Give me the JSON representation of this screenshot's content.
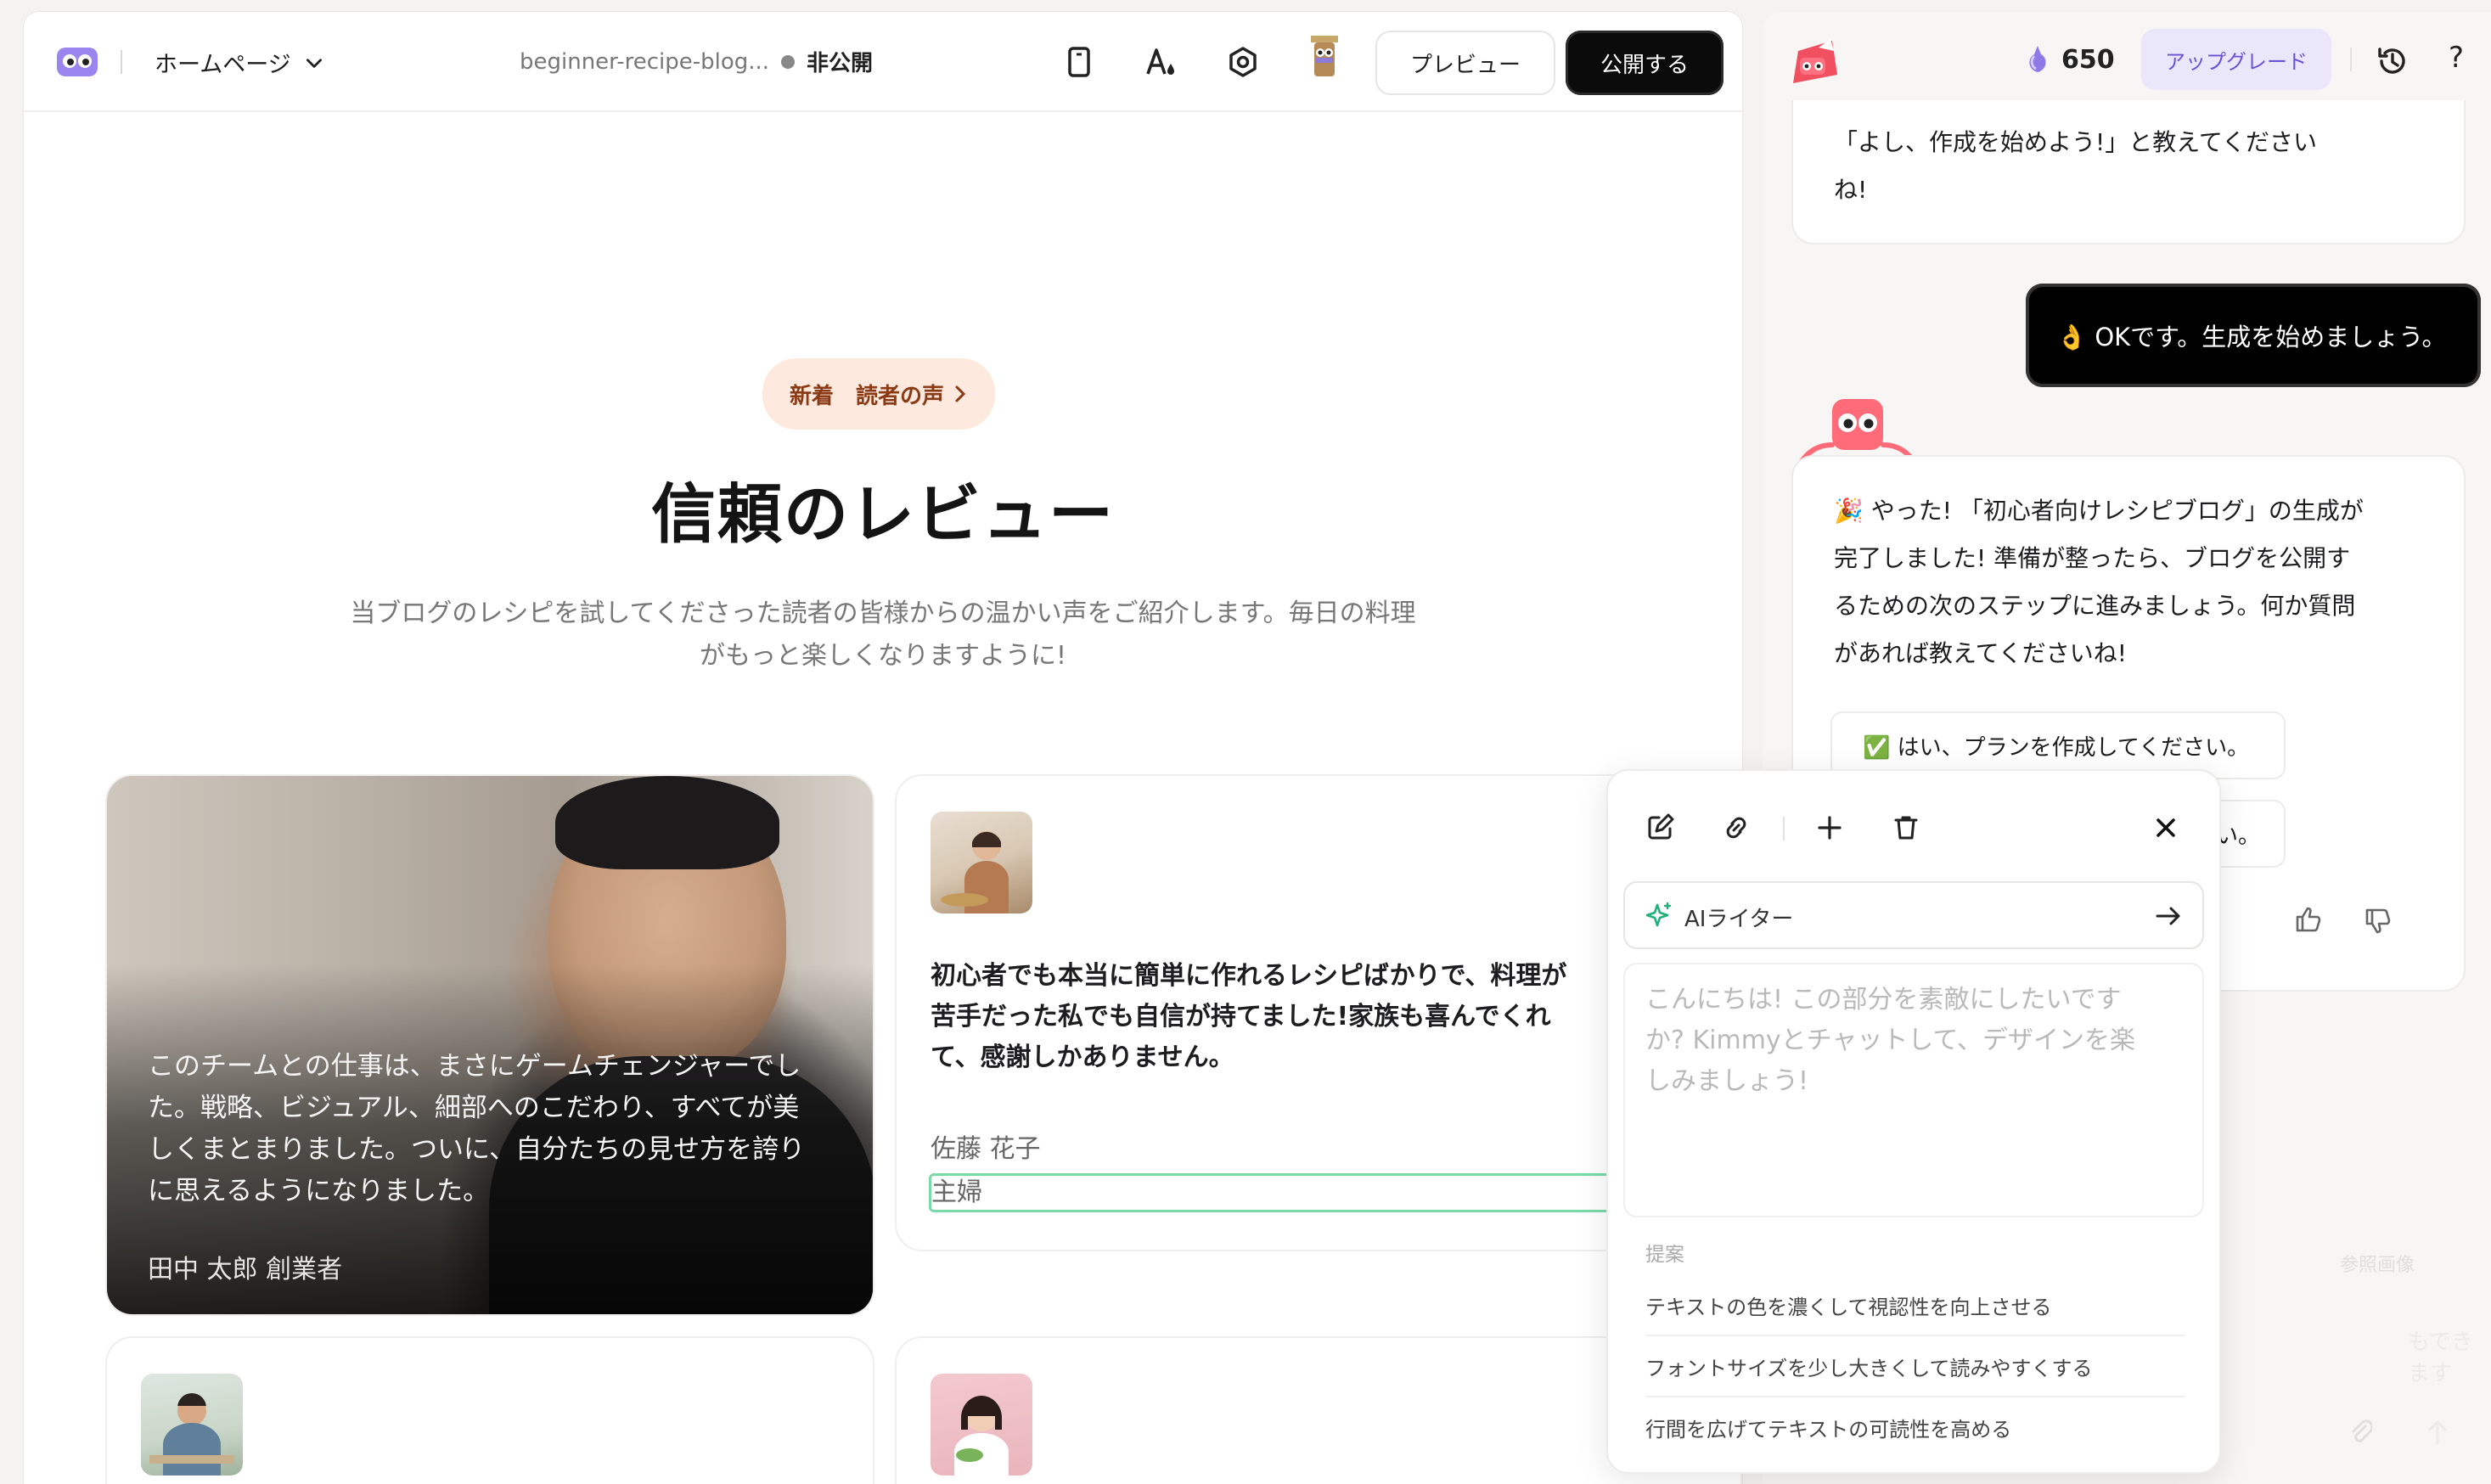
{
  "topbar": {
    "page_selector": "ホームページ",
    "site_name": "beginner-recipe-blog...",
    "visibility": "非公開",
    "preview_label": "プレビュー",
    "publish_label": "公開する"
  },
  "hero": {
    "badge_new": "新着",
    "badge_link": "読者の声",
    "title": "信頼のレビュー",
    "subtitle_line1": "当ブログのレシピを試してくださった読者の皆様からの温かい声をご紹介します。毎日の料理",
    "subtitle_line2": "がもっと楽しくなりますように!"
  },
  "testimonials": [
    {
      "quote_lines": [
        "このチームとの仕事は、まさにゲームチェンジャーでし",
        "た。戦略、ビジュアル、細部へのこだわり、すべてが美",
        "しくまとまりました。ついに、自分たちの見せ方を誇り",
        "に思えるようになりました。"
      ],
      "author": "田中 太郎  創業者"
    },
    {
      "quote_lines": [
        "初心者でも本当に簡単に作れるレシピばかりで、料理が",
        "苦手だった私でも自信が持てました!家族も喜んでくれ",
        "て、感謝しかありません。"
      ],
      "author": "佐藤 花子",
      "role": "主婦"
    }
  ],
  "ai_writer": {
    "label": "AIライター",
    "placeholder_lines": [
      "こんにちは! この部分を素敵にしたいです",
      "か? Kimmyとチャットして、デザインを楽",
      "しみましょう!"
    ],
    "suggestions_label": "提案",
    "suggestions": [
      "テキストの色を濃くして視認性を向上させる",
      "フォントサイズを少し大きくして読みやすくする",
      "行間を広げてテキストの可読性を高める"
    ]
  },
  "chat": {
    "credits": "650",
    "upgrade_label": "アップグレード",
    "help_label": "?",
    "prev_bubble_lines": [
      "「よし、作成を始めよう!」と教えてください",
      "ね!"
    ],
    "user_message": "👌 OKです。生成を始めましょう。",
    "bot_reply_lines": [
      "🎉 やった! 「初心者向けレシピブログ」の生成が",
      "完了しました! 準備が整ったら、ブログを公開す",
      "るための次のステップに進みましょう。何か質問",
      "があれば教えてくださいね!"
    ],
    "option_1": "✅ はい、プランを作成してください。",
    "option_2_tail": "い。",
    "ghost_ref": "参照画像",
    "ghost_hint": "   もできます"
  },
  "colors": {
    "accent_purple": "#6a52d6",
    "badge_bg": "#fde9dd",
    "ai_green": "#1fb07a",
    "selection_green": "#7bd9a9"
  }
}
